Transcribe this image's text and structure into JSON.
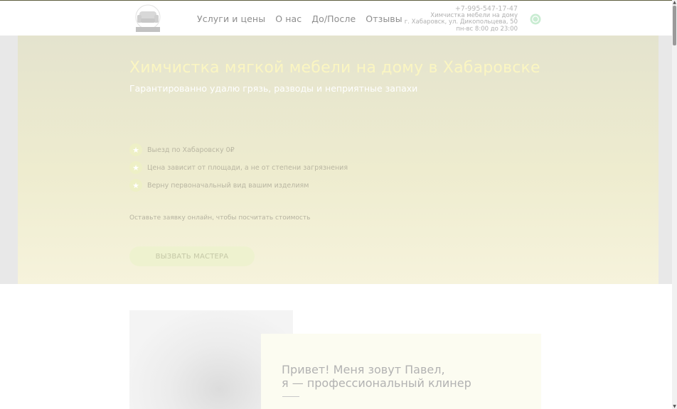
{
  "header": {
    "logo_icon": "sofa-logo-icon",
    "nav": [
      {
        "label": "Услуги и цены"
      },
      {
        "label": "О нас"
      },
      {
        "label": "До/После"
      },
      {
        "label": "Отзывы"
      }
    ],
    "phone": "+7-995-547-17-47",
    "company": "Химчистка мебели на дому",
    "address": "г. Хабаровск, ул. Дикопольцева, 50",
    "hours": "пн-вс 8:00 до 23:00",
    "messenger_icon": "whatsapp-icon"
  },
  "hero": {
    "title": "Химчистка мягкой мебели на дому в Хабаровске",
    "subtitle": "Гарантированно удалю грязь, разводы и неприятные запахи",
    "features": [
      {
        "icon": "star-icon",
        "text": "Выезд по Хабаровску 0₽"
      },
      {
        "icon": "star-icon",
        "text": "Цена зависит от площади, а не от степени загрязнения"
      },
      {
        "icon": "star-icon",
        "text": "Верну первоначальный вид вашим изделиям"
      }
    ],
    "cta_note": "Оставьте заявку онлайн, чтобы посчитать стоимость",
    "cta_button": "ВЫЗВАТЬ МАСТЕРА"
  },
  "about": {
    "title_line1": "Привет! Меня зовут Павел,",
    "title_line2": "я — профессиональный клинер"
  },
  "colors": {
    "hero_title": "#fbf6c2",
    "hero_bg": "#eeeccf",
    "button_bg": "#eef2cf",
    "messenger_green": "#c9ecd2"
  }
}
